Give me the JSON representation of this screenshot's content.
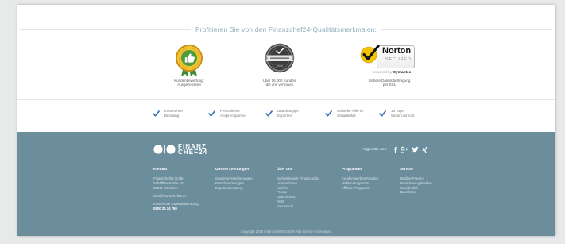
{
  "quality": {
    "title": "Profitieren Sie von den Finanzchef24-Qualitätsmerkmalen:",
    "badges": [
      {
        "caption": [
          "Kundenbewertung:",
          "Ausgezeichnet"
        ]
      },
      {
        "caption": [
          "Über 16.000 Kunden,",
          "die uns vertrauen"
        ]
      },
      {
        "caption": [
          "Sichere Datenübertragung",
          "per SSL"
        ]
      }
    ],
    "norton": {
      "brand": "Norton",
      "secured": "SECURED",
      "powered_by": "powered by",
      "vendor": "Symantec"
    }
  },
  "features": [
    {
      "icon": "check-icon",
      "lines": [
        "Kostenfreie",
        "Beratung"
      ]
    },
    {
      "icon": "check-icon",
      "lines": [
        "Persönlicher",
        "Ansprechpartner"
      ]
    },
    {
      "icon": "check-icon",
      "lines": [
        "Unabhängige",
        "Experten"
      ]
    },
    {
      "icon": "check-icon",
      "lines": [
        "Schnelle Hilfe im",
        "Schadenfall"
      ]
    },
    {
      "icon": "check-icon",
      "lines": [
        "14 Tage",
        "Widerrufsrecht"
      ]
    }
  ],
  "footer": {
    "logo": [
      "FINANZ",
      "CHEF24"
    ],
    "follow_label": "Folgen Sie uns:",
    "social": [
      "facebook-icon",
      "google-plus-icon",
      "twitter-icon",
      "xing-icon"
    ],
    "columns": [
      {
        "heading": "Kontakt",
        "groups": [
          [
            "Finanzchef24 GmbH",
            "Schäftlarnstraße 10",
            "81371 München"
          ],
          [
            "info@finanzchef24.de"
          ],
          [
            "Kostenlose Expertenberatung:",
            "0800 24 24 780"
          ]
        ]
      },
      {
        "heading": "Unsere Leistungen",
        "items": [
          "Gewerbeversicherungen",
          "Branchenlösungen",
          "Expertenberatung"
        ]
      },
      {
        "heading": "Über uns",
        "items": [
          "So funktioniert Finanzchef24",
          "Unternehmen",
          "Karriere",
          "Presse",
          "Datenschutz",
          "AGB",
          "Impressum"
        ]
      },
      {
        "heading": "Programme",
        "items": [
          "Kunden werben Kunden",
          "Makler-Programm",
          "Affiliate-Programm"
        ]
      },
      {
        "heading": "Service",
        "items": [
          "Häufige Fragen",
          "Versicherungslexikon",
          "Schadenfall",
          "Newsletter"
        ]
      }
    ],
    "copyright": "Copyright 2015 Finanzchef24 GmbH. Alle Rechte vorbehalten."
  },
  "colors": {
    "check_accent": "#3a76b8",
    "footer_background": "#6c8e9c",
    "title_text": "#8fadbb",
    "norton_yellow": "#f6c100"
  }
}
